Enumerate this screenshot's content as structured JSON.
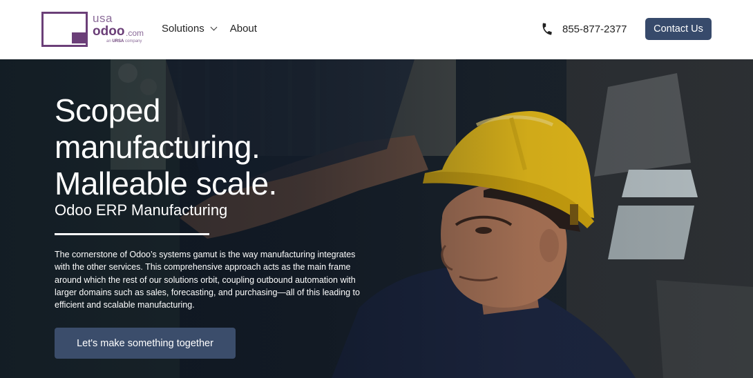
{
  "logo": {
    "line1": "usa",
    "line2": "odoo",
    "suffix": ".com",
    "tagline_prefix": "an",
    "tagline_brand": "URSA",
    "tagline_suffix": "company"
  },
  "nav": {
    "items": [
      {
        "label": "Solutions",
        "has_dropdown": true
      },
      {
        "label": "About",
        "has_dropdown": false
      }
    ]
  },
  "header": {
    "phone": "855-877-2377",
    "contact_label": "Contact Us"
  },
  "hero": {
    "title_lines": [
      "Scoped",
      "manufacturing.",
      "Malleable scale."
    ],
    "subtitle": "Odoo ERP Manufacturing",
    "body": "The cornerstone of Odoo’s systems gamut is the way manufacturing integrates with the other services. This comprehensive approach acts as the main frame around which the rest of our solutions orbit, coupling outbound automation with larger domains such as sales, forecasting, and purchasing—all of this leading to efficient and scalable manufacturing.",
    "cta_label": "Let's make something together"
  },
  "colors": {
    "brand_purple": "#6b3f78",
    "button_navy": "#374a6b",
    "helmet_yellow": "#f2c418"
  },
  "icons": {
    "phone": "phone-icon",
    "dropdown": "chevron-down-icon"
  }
}
